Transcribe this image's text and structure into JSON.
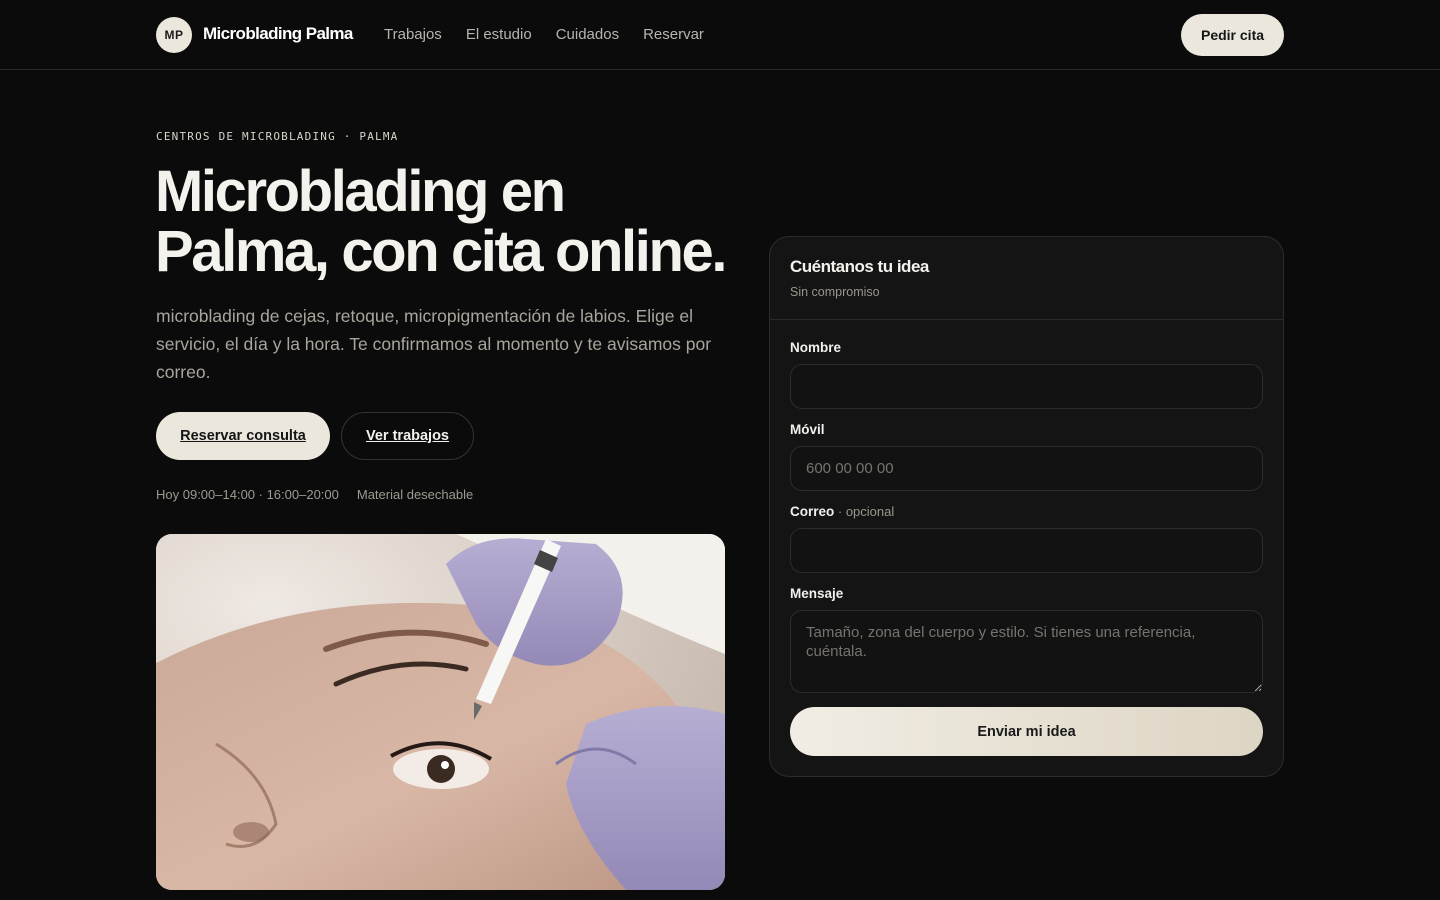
{
  "header": {
    "logo_initials": "MP",
    "brand": "Microblading Palma",
    "nav": [
      "Trabajos",
      "El estudio",
      "Cuidados",
      "Reservar"
    ],
    "cta": "Pedir cita"
  },
  "hero": {
    "eyebrow": "CENTROS DE MICROBLADING · PALMA",
    "title_line1": "Microblading en",
    "title_line2": "Palma, con cita online.",
    "lead": "microblading de cejas, retoque, micropigmentación de labios. Elige el servicio, el día y la hora. Te confirmamos al momento y te avisamos por correo.",
    "primary_button": "Reservar consulta",
    "secondary_button": "Ver trabajos",
    "hours": "Hoy 09:00–14:00 · 16:00–20:00",
    "material": "Material desechable"
  },
  "form": {
    "title": "Cuéntanos tu idea",
    "subtitle": "Sin compromiso",
    "name_label": "Nombre",
    "name_value": "",
    "mobile_label": "Móvil",
    "mobile_placeholder": "600 00 00 00",
    "email_label": "Correo",
    "email_optional": " · opcional",
    "email_value": "",
    "message_label": "Mensaje",
    "message_placeholder": "Tamaño, zona del cuerpo y estilo. Si tienes una referencia, cuéntala.",
    "submit": "Enviar mi idea"
  },
  "colors": {
    "background": "#0b0b0b",
    "accent_cream": "#ebe7dd",
    "card": "#141414",
    "glove_lilac": "#a89fc6"
  }
}
